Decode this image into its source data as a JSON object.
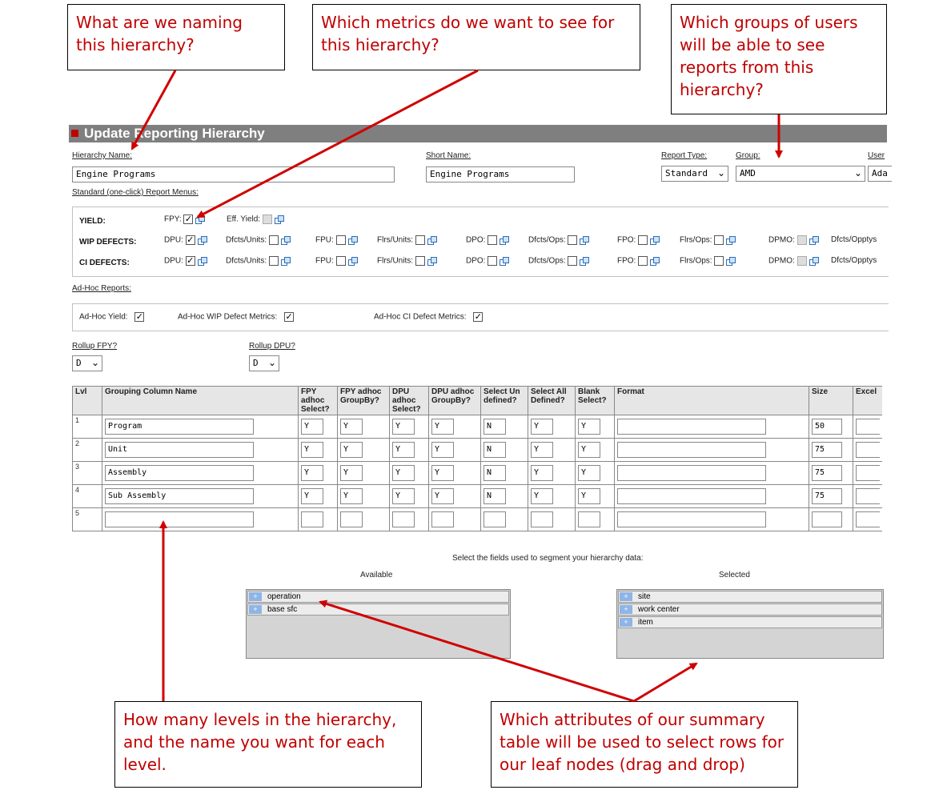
{
  "callouts": {
    "naming": "What are we naming this hierarchy?",
    "metrics": "Which metrics do we want to see for this hierarchy?",
    "groups": "Which groups of users will be able to see reports from this hierarchy?",
    "levels": "How many levels in the hierarchy, and the name you want for each level.",
    "attributes": "Which attributes of our summary table will be used to select rows for our leaf nodes (drag and drop)"
  },
  "header": {
    "title": "Update Reporting Hierarchy"
  },
  "fields": {
    "hierarchy_name_label": "Hierarchy Name:",
    "hierarchy_name_value": "Engine Programs",
    "short_name_label": "Short Name:",
    "short_name_value": "Engine Programs",
    "report_type_label": "Report Type:",
    "report_type_value": "Standard",
    "group_label": "Group:",
    "group_value": "AMD",
    "user_label": "User",
    "user_value": "Ada"
  },
  "standard_menus": {
    "label": "Standard (one-click) Report Menus:",
    "yield": {
      "label": "YIELD:",
      "fpy": "FPY:",
      "eff_yield": "Eff. Yield:"
    },
    "wip": {
      "label": "WIP DEFECTS:",
      "items": [
        "DPU:",
        "Dfcts/Units:",
        "FPU:",
        "Flrs/Units:",
        "DPO:",
        "Dfcts/Ops:",
        "FPO:",
        "Flrs/Ops:",
        "DPMO:",
        "Dfcts/Opptys"
      ]
    },
    "ci": {
      "label": "CI DEFECTS:",
      "items": [
        "DPU:",
        "Dfcts/Units:",
        "FPU:",
        "Flrs/Units:",
        "DPO:",
        "Dfcts/Ops:",
        "FPO:",
        "Flrs/Ops:",
        "DPMO:",
        "Dfcts/Opptys"
      ]
    }
  },
  "adhoc": {
    "label": "Ad-Hoc Reports:",
    "yield": "Ad-Hoc Yield:",
    "wip": "Ad-Hoc WIP Defect Metrics:",
    "ci": "Ad-Hoc CI Defect Metrics:"
  },
  "rollup": {
    "fpy_label": "Rollup FPY?",
    "fpy_value": "D",
    "dpu_label": "Rollup DPU?",
    "dpu_value": "D"
  },
  "grid": {
    "headers": {
      "lvl": "Lvl",
      "name": "Grouping Column Name",
      "fpy_select": "FPY adhoc Select?",
      "fpy_groupby": "FPY adhoc GroupBy?",
      "dpu_select": "DPU adhoc Select?",
      "dpu_groupby": "DPU adhoc GroupBy?",
      "undefined": "Select Un defined?",
      "all_defined": "Select All Defined?",
      "blank": "Blank Select?",
      "format": "Format",
      "size": "Size",
      "excel": "Excel"
    },
    "rows": [
      {
        "lvl": "1",
        "name": "Program",
        "c1": "Y",
        "c2": "Y",
        "c3": "Y",
        "c4": "Y",
        "c5": "N",
        "c6": "Y",
        "c7": "Y",
        "format": "",
        "size": "50"
      },
      {
        "lvl": "2",
        "name": "Unit",
        "c1": "Y",
        "c2": "Y",
        "c3": "Y",
        "c4": "Y",
        "c5": "N",
        "c6": "Y",
        "c7": "Y",
        "format": "",
        "size": "75"
      },
      {
        "lvl": "3",
        "name": "Assembly",
        "c1": "Y",
        "c2": "Y",
        "c3": "Y",
        "c4": "Y",
        "c5": "N",
        "c6": "Y",
        "c7": "Y",
        "format": "",
        "size": "75"
      },
      {
        "lvl": "4",
        "name": "Sub Assembly",
        "c1": "Y",
        "c2": "Y",
        "c3": "Y",
        "c4": "Y",
        "c5": "N",
        "c6": "Y",
        "c7": "Y",
        "format": "",
        "size": "75"
      },
      {
        "lvl": "5",
        "name": "",
        "c1": "",
        "c2": "",
        "c3": "",
        "c4": "",
        "c5": "",
        "c6": "",
        "c7": "",
        "format": "",
        "size": ""
      }
    ]
  },
  "segment": {
    "prompt": "Select the fields used to segment your hierarchy data:",
    "available_label": "Available",
    "selected_label": "Selected",
    "available": [
      "operation",
      "base sfc"
    ],
    "selected": [
      "site",
      "work center",
      "item"
    ]
  },
  "colors": {
    "accent_red": "#c00000",
    "titlebar": "#7f7f7f",
    "link_blue": "#2a6ebb"
  }
}
